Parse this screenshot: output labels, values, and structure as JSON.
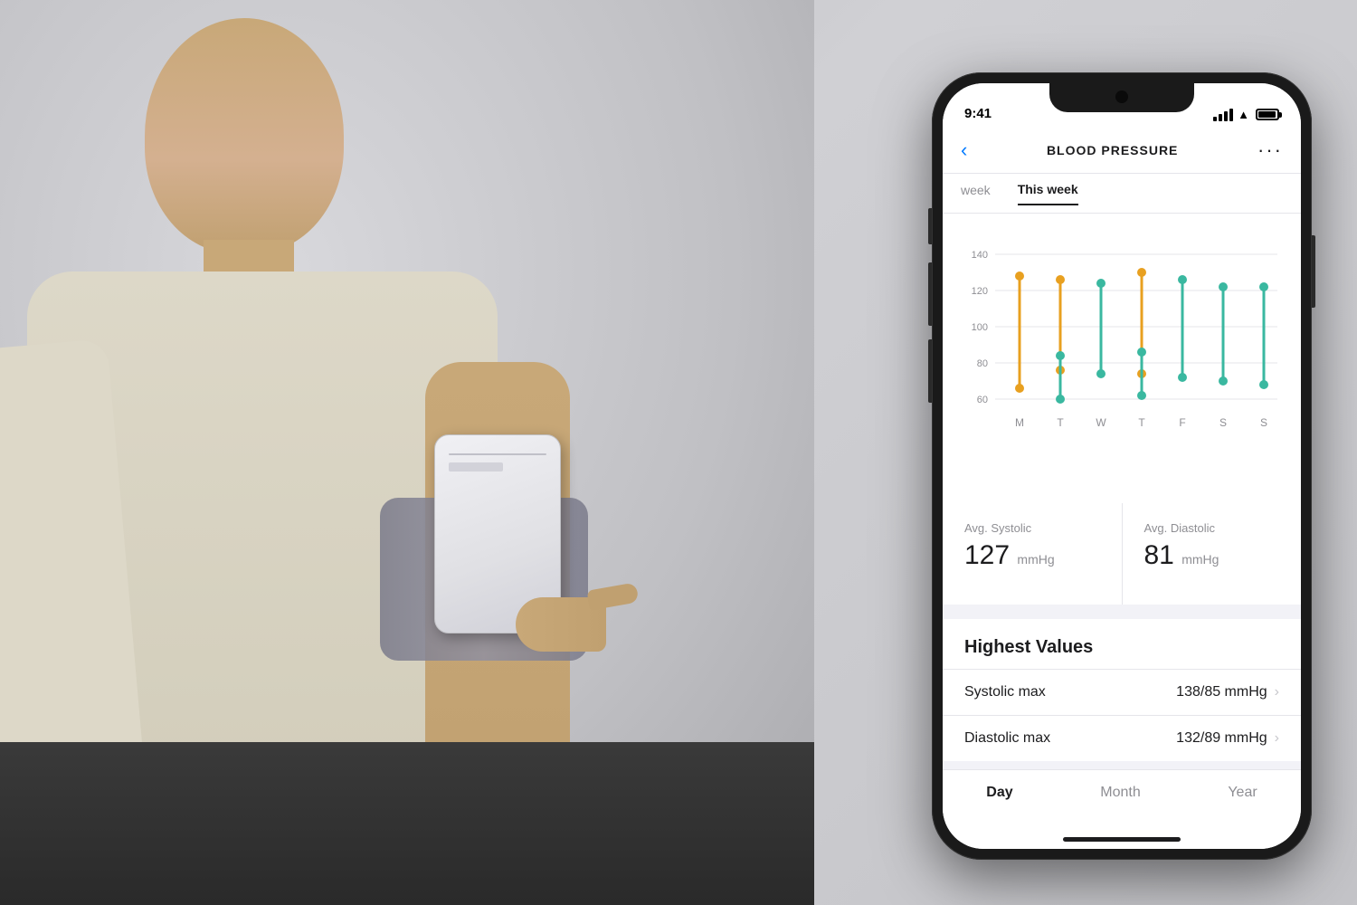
{
  "scene": {
    "background_color": "#c8c8cc"
  },
  "phone": {
    "status_bar": {
      "time": "9:41"
    },
    "header": {
      "title": "BLOOD PRESSURE",
      "back_label": "‹",
      "more_label": "···"
    },
    "week_tabs": [
      {
        "label": "week",
        "active": false
      },
      {
        "label": "This week",
        "active": true
      }
    ],
    "chart": {
      "y_labels": [
        "140",
        "120",
        "100",
        "80",
        "60"
      ],
      "x_labels": [
        "M",
        "T",
        "W",
        "T",
        "F",
        "S",
        "S"
      ]
    },
    "stats": {
      "systolic_label": "Avg. Systolic",
      "systolic_value": "127",
      "systolic_unit": "mmHg",
      "diastolic_label": "Avg. Diastolic",
      "diastolic_value": "81",
      "diastolic_unit": "mmHg"
    },
    "highest_values": {
      "title": "Highest Values",
      "rows": [
        {
          "label": "Systolic max",
          "value": "138/85 mmHg"
        },
        {
          "label": "Diastolic max",
          "value": "132/89 mmHg"
        }
      ]
    },
    "bottom_tabs": [
      {
        "label": "Day",
        "active": true
      },
      {
        "label": "Month",
        "active": false
      },
      {
        "label": "Year",
        "active": false
      }
    ],
    "colors": {
      "systolic_dot": "#e8a020",
      "diastolic_dot": "#3ab8a0",
      "line": "#555"
    }
  }
}
